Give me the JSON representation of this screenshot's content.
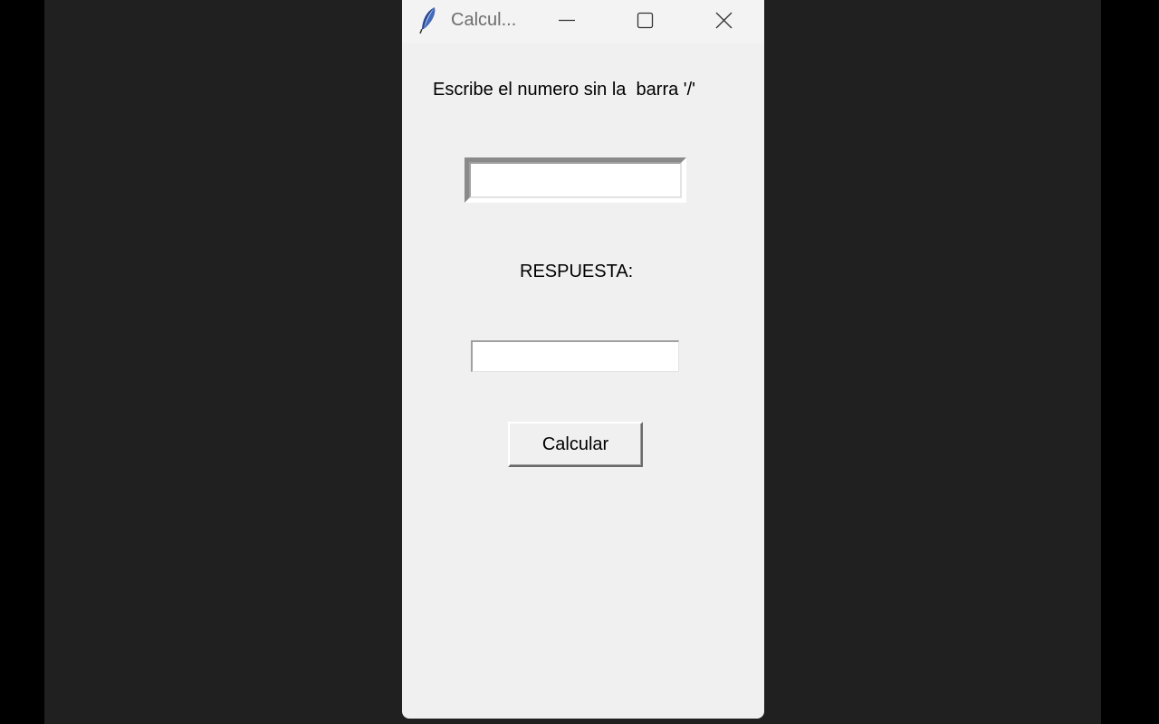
{
  "window": {
    "title": "Calcul...",
    "app_icon": "feather-icon",
    "controls": {
      "minimize": "minimize-icon",
      "maximize": "maximize-icon",
      "close": "close-icon"
    }
  },
  "form": {
    "instruction_label": "Escribe el numero sin la  barra '/'",
    "input_value": "",
    "response_label": "RESPUESTA:",
    "response_value": "",
    "calculate_button": "Calcular"
  }
}
